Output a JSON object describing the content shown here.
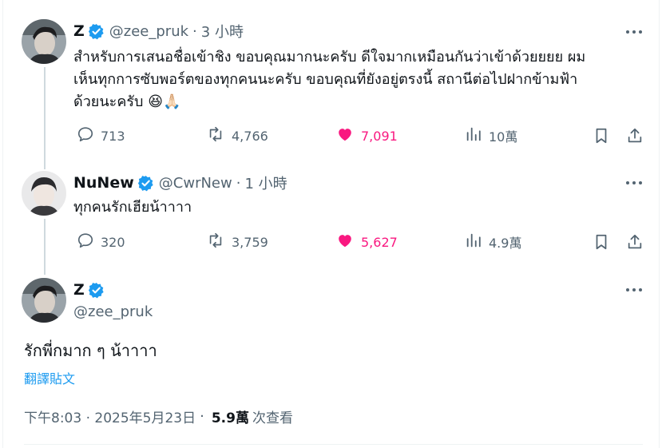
{
  "tweets": [
    {
      "name": "Z",
      "handle": "@zee_pruk",
      "separator": "·",
      "time": "3 小時",
      "lines": [
        "สำหรับการเสนอชื่อเข้าชิง ขอบคุณมากนะครับ ดีใจมากเหมือนกันว่าเข้าด้วยยยย ผม",
        "เห็นทุกการซับพอร์ตของทุกคนนะครับ ขอบคุณที่ยังอยู่ตรงนี้ สถานีต่อไปฝากข้ามฟ้า",
        "ด้วยนะครับ"
      ],
      "emoji": "😆🙏🏻",
      "replies": "713",
      "reposts": "4,766",
      "likes": "7,091",
      "views": "10萬"
    },
    {
      "name": "NuNew",
      "handle": "@CwrNew",
      "separator": "·",
      "time": "1 小時",
      "text": "ทุกคนรักเฮียน้าาาา",
      "replies": "320",
      "reposts": "3,759",
      "likes": "5,627",
      "views": "4.9萬"
    }
  ],
  "main": {
    "name": "Z",
    "handle": "@zee_pruk",
    "text": "รักพี่กมาก ๆ น้าาาา",
    "translate_label": "翻譯貼文",
    "timestamp": "下午8:03 · 2025年5月23日",
    "separator": "·",
    "views_count": "5.9萬",
    "views_label": "次查看"
  },
  "icons": {
    "verified": "verified-badge-icon",
    "more": "more-icon",
    "reply": "reply-icon",
    "repost": "repost-icon",
    "like": "heart-icon",
    "views": "views-icon",
    "bookmark": "bookmark-icon",
    "share": "share-icon"
  },
  "colors": {
    "verified": "#1d9bf0",
    "like": "#f91880",
    "secondary_text": "#536471",
    "link": "#1d9bf0"
  }
}
